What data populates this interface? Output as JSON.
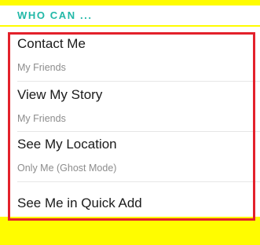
{
  "section": {
    "title": "WHO CAN ..."
  },
  "settings": [
    {
      "title": "Contact Me",
      "value": "My Friends"
    },
    {
      "title": "View My Story",
      "value": "My Friends"
    },
    {
      "title": "See My Location",
      "value": "Only Me (Ghost Mode)"
    },
    {
      "title": "See Me in Quick Add",
      "value": ""
    }
  ],
  "colors": {
    "background": "#FFFC00",
    "section_title": "#21b8a7",
    "highlight": "#e3212b"
  }
}
